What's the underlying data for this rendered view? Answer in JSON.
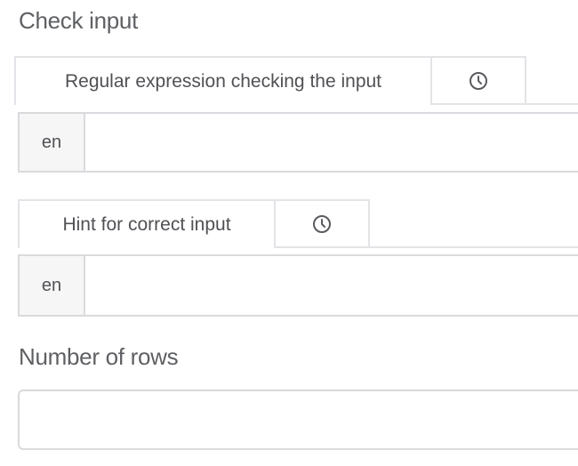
{
  "check_input": {
    "heading": "Check input",
    "regex": {
      "tab_label": "Regular expression checking the input",
      "history_icon": "clock-icon",
      "lang": "en",
      "value": ""
    },
    "hint": {
      "tab_label": "Hint for correct input",
      "history_icon": "clock-icon",
      "lang": "en",
      "value": ""
    }
  },
  "rows": {
    "heading": "Number of rows",
    "value": ""
  }
}
